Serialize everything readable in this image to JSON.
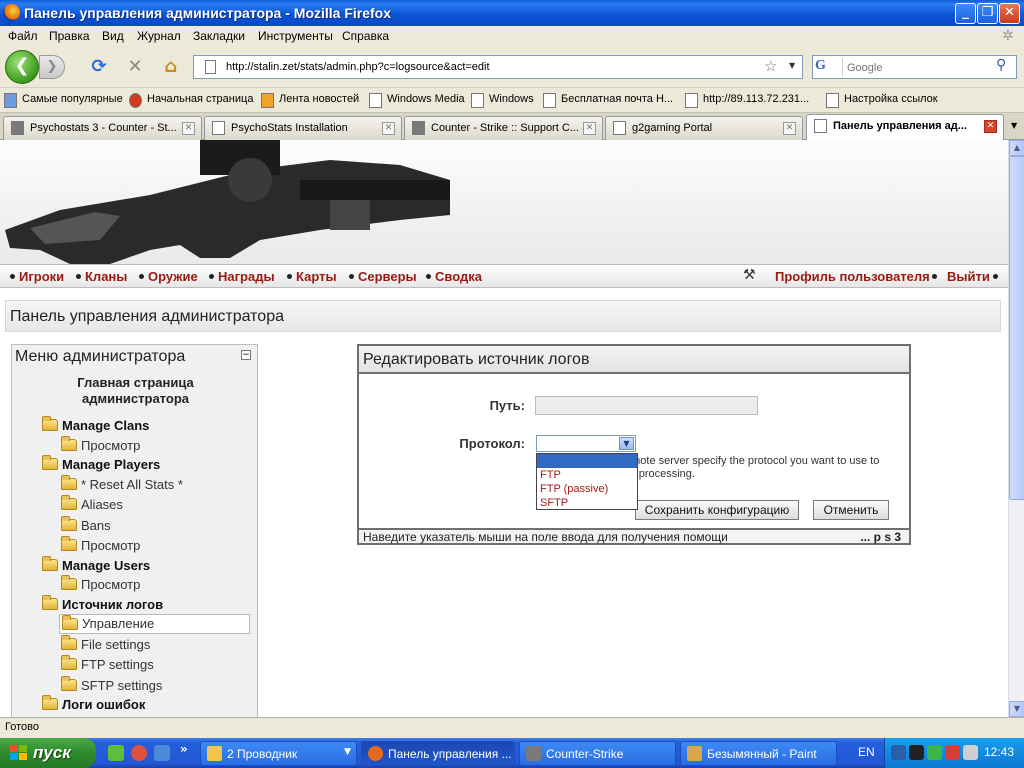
{
  "window": {
    "title": "Панель управления администратора - Mozilla Firefox",
    "minimize": "_",
    "maximize": "❐",
    "close": "✕"
  },
  "menubar": [
    "Файл",
    "Правка",
    "Вид",
    "Журнал",
    "Закладки",
    "Инструменты",
    "Справка"
  ],
  "nav": {
    "back": "❮",
    "forward": "❯",
    "url": "http://stalin.zet/stats/admin.php?c=logsource&act=edit",
    "search_placeholder": "Google",
    "search_engine": "G"
  },
  "bookmarks": [
    "Самые популярные",
    "Начальная страница",
    "Лента новостей",
    "Windows Media",
    "Windows",
    "Бесплатная почта H...",
    "http://89.113.72.231...",
    "Настройка ссылок"
  ],
  "tabs": [
    {
      "label": "Psychostats 3 - Counter - St..."
    },
    {
      "label": "PsychoStats Installation"
    },
    {
      "label": "Counter - Strike :: Support C..."
    },
    {
      "label": "g2gaming Portal"
    },
    {
      "label": "Панель управления ад..."
    }
  ],
  "site_nav": {
    "left": [
      "Игроки",
      "Кланы",
      "Оружие",
      "Награды",
      "Карты",
      "Серверы",
      "Сводка"
    ],
    "right": [
      "Профиль пользователя",
      "Выйти"
    ]
  },
  "page_title": "Панель управления администратора",
  "admin_menu": {
    "title": "Меню администратора",
    "collapse": "−",
    "home_line1": "Главная страница",
    "home_line2": "администратора",
    "items": [
      {
        "label": "Manage Clans"
      },
      {
        "label": "Просмотр"
      },
      {
        "label": "Manage Players"
      },
      {
        "label": "* Reset All Stats *"
      },
      {
        "label": "Aliases"
      },
      {
        "label": "Bans"
      },
      {
        "label": "Просмотр"
      },
      {
        "label": "Manage Users"
      },
      {
        "label": "Просмотр"
      },
      {
        "label": "Источник логов"
      },
      {
        "label": "Управление"
      },
      {
        "label": "File settings"
      },
      {
        "label": "FTP settings"
      },
      {
        "label": "SFTP settings"
      },
      {
        "label": "Логи ошибок"
      }
    ]
  },
  "edit_panel": {
    "title": "Редактировать источник логов",
    "path_label": "Путь:",
    "path_value": "",
    "protocol_label": "Протокол:",
    "protocol_selected": "",
    "options": [
      "",
      "FTP",
      "FTP (passive)",
      "SFTP"
    ],
    "help_line1": "emote server specify the protocol you want to use to",
    "help_line2": "r processing.",
    "save_button": "Сохранить конфигурацию",
    "cancel_button": "Отменить",
    "footer_hint": "Наведите указатель мыши на поле ввода для получения помощи",
    "footer_version": "... p s 3"
  },
  "status": "Готово",
  "taskbar": {
    "start": "пуск",
    "tasks": [
      {
        "label": "2 Проводник"
      },
      {
        "label": "Панель управления ..."
      },
      {
        "label": "Counter-Strike"
      },
      {
        "label": "Безымянный - Paint"
      }
    ],
    "more": "»",
    "lang": "EN",
    "clock": "12:43"
  }
}
